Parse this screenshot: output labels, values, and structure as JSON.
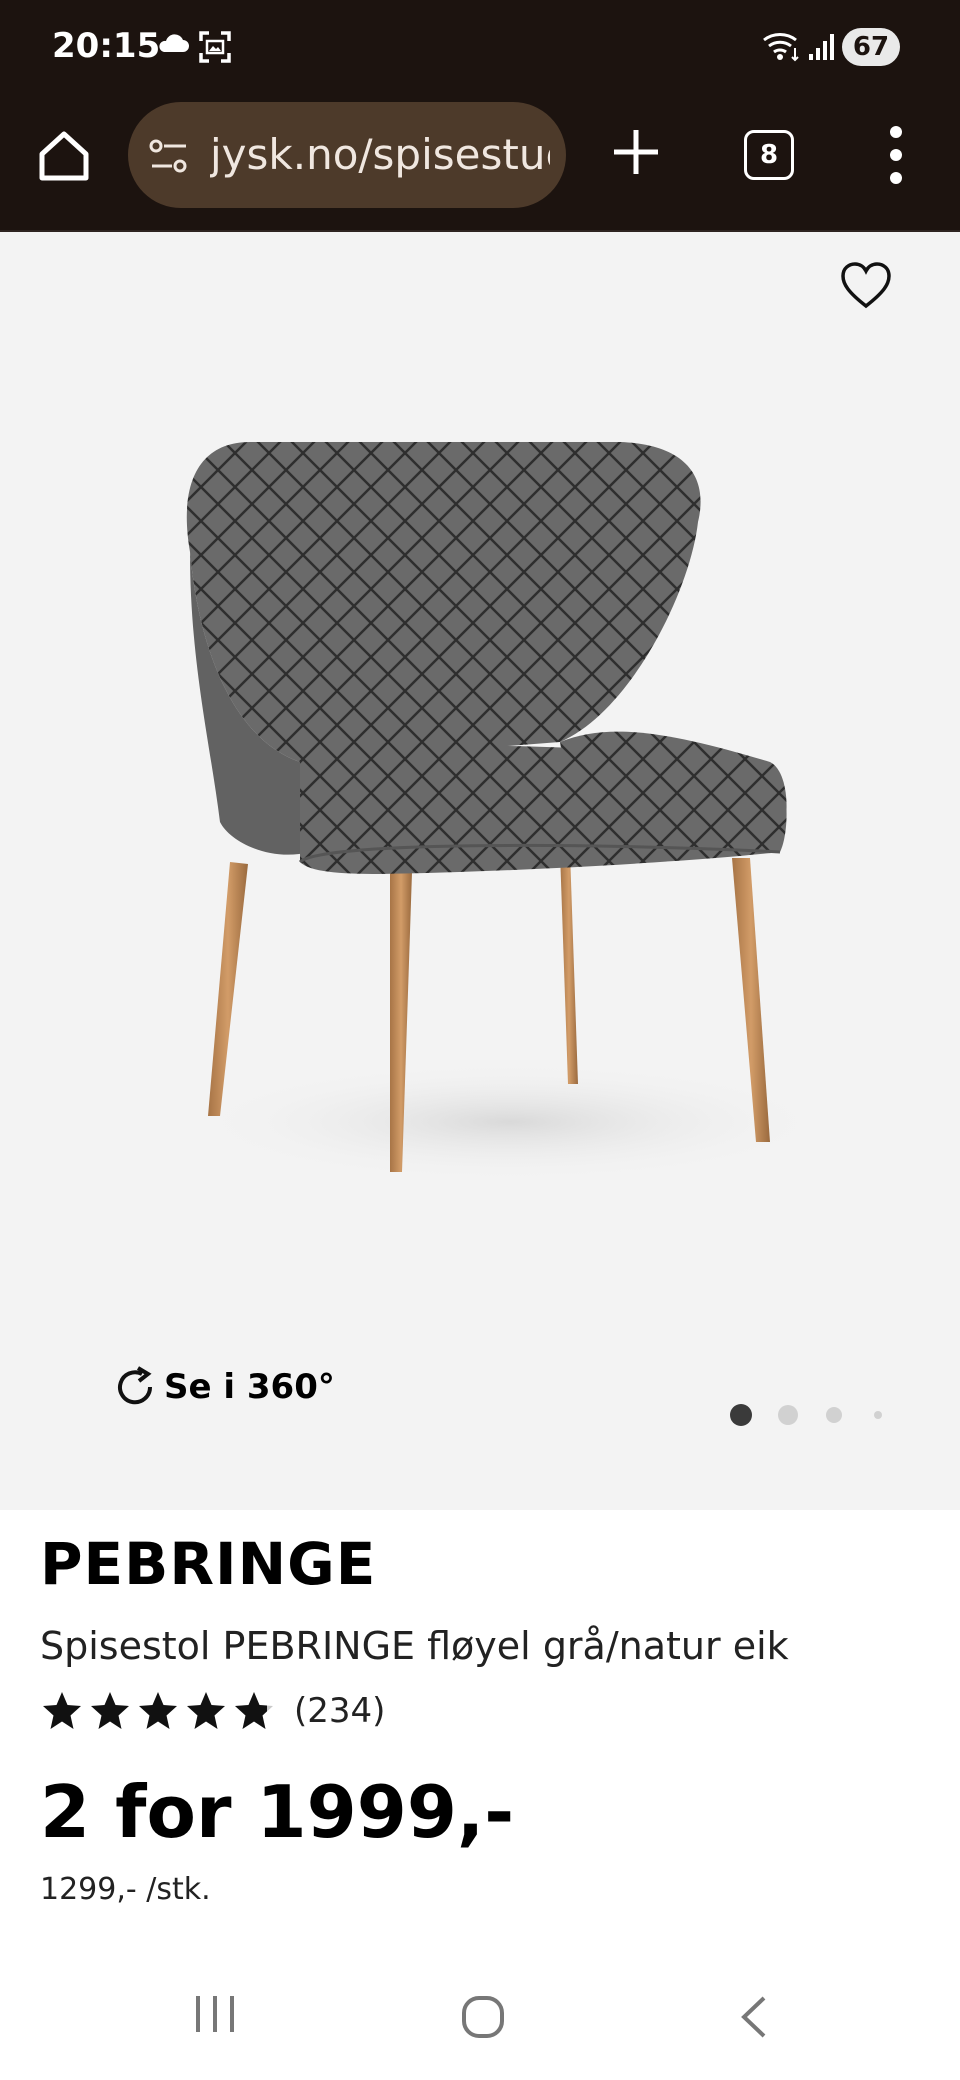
{
  "status_bar": {
    "time": "20:15",
    "battery": "67",
    "icons": [
      "cloud-icon",
      "screen-capture-icon",
      "wifi-icon",
      "signal-icon",
      "battery-icon"
    ]
  },
  "browser": {
    "url": "jysk.no/spisestue/",
    "tab_count": "8",
    "icons": [
      "home-icon",
      "tune-icon",
      "plus-icon",
      "menu-icon"
    ]
  },
  "product": {
    "brand": "PEBRINGE",
    "description": "Spisestol PEBRINGE fløyel grå/natur eik",
    "rating": 4.8,
    "review_count": "(234)",
    "price": "2 for 1999,-",
    "unit_price": "1299,- /stk.",
    "view_360_label": "Se i 360°",
    "image_count": 4,
    "current_image": 1
  },
  "nav_bar": {
    "icons": [
      "recents-icon",
      "home-circle-icon",
      "back-icon"
    ]
  },
  "colors": {
    "chrome": "#1c130f",
    "url_bar": "#4d3a2a",
    "image_bg": "#f3f3f3"
  }
}
